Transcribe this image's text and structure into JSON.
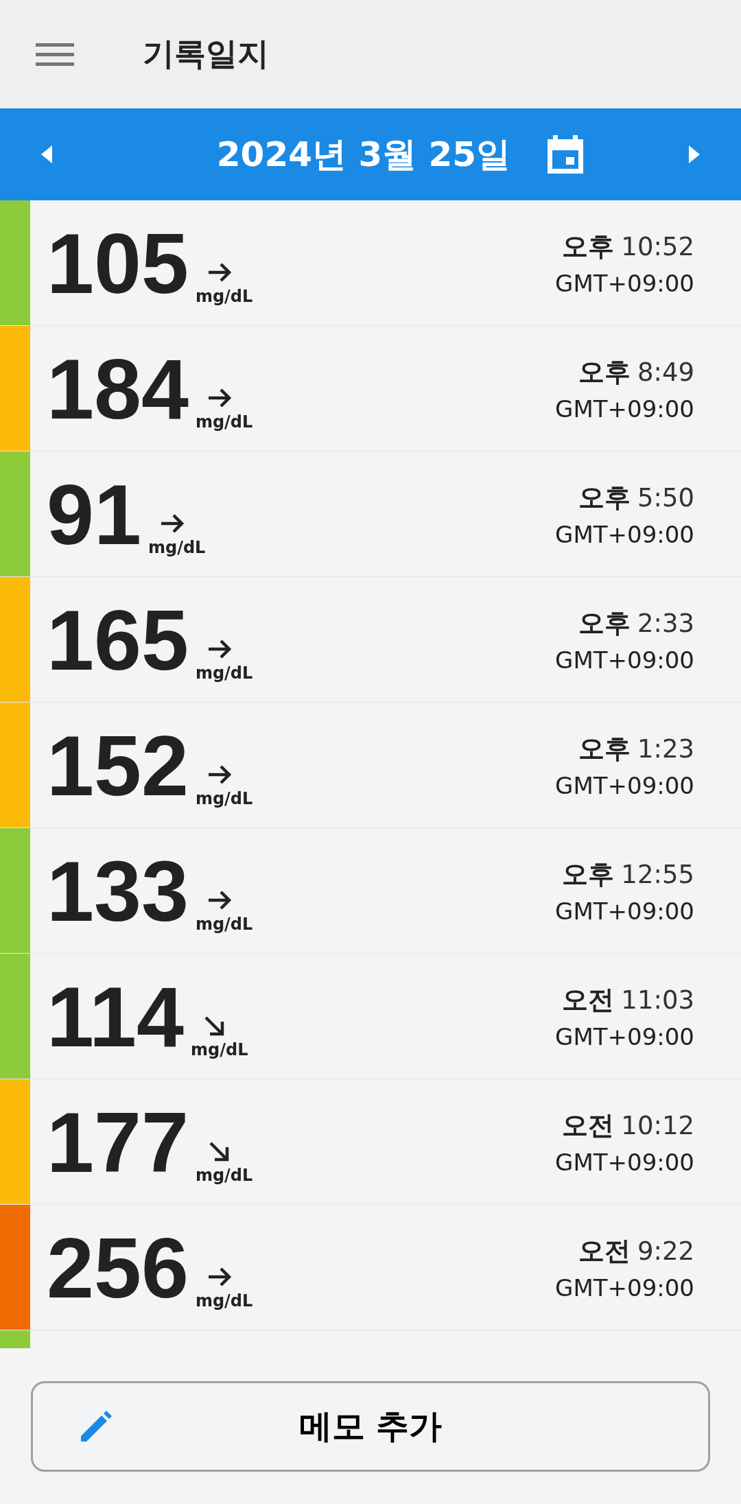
{
  "app_bar": {
    "title": "기록일지"
  },
  "date_bar": {
    "date": "2024년 3월 25일"
  },
  "readings": [
    {
      "value": "105",
      "kind": "steady",
      "unit": "mg/dL",
      "period": "오후",
      "time": "10:52",
      "timezone": "GMT+09:00",
      "color": "#8dcb3a"
    },
    {
      "value": "184",
      "kind": "steady",
      "unit": "mg/dL",
      "period": "오후",
      "time": "8:49",
      "timezone": "GMT+09:00",
      "color": "#fdbb09"
    },
    {
      "value": "91",
      "kind": "steady",
      "unit": "mg/dL",
      "period": "오후",
      "time": "5:50",
      "timezone": "GMT+09:00",
      "color": "#8dcb3a"
    },
    {
      "value": "165",
      "kind": "steady",
      "unit": "mg/dL",
      "period": "오후",
      "time": "2:33",
      "timezone": "GMT+09:00",
      "color": "#fdbb09"
    },
    {
      "value": "152",
      "kind": "steady",
      "unit": "mg/dL",
      "period": "오후",
      "time": "1:23",
      "timezone": "GMT+09:00",
      "color": "#fdbb09"
    },
    {
      "value": "133",
      "kind": "steady",
      "unit": "mg/dL",
      "period": "오후",
      "time": "12:55",
      "timezone": "GMT+09:00",
      "color": "#8dcb3a"
    },
    {
      "value": "114",
      "kind": "falling",
      "unit": "mg/dL",
      "period": "오전",
      "time": "11:03",
      "timezone": "GMT+09:00",
      "color": "#8dcb3a"
    },
    {
      "value": "177",
      "kind": "falling",
      "unit": "mg/dL",
      "period": "오전",
      "time": "10:12",
      "timezone": "GMT+09:00",
      "color": "#fdbb09"
    },
    {
      "value": "256",
      "kind": "steady",
      "unit": "mg/dL",
      "period": "오전",
      "time": "9:22",
      "timezone": "GMT+09:00",
      "color": "#ef6c00"
    }
  ],
  "partial_row": {
    "color": "#8dcb3a"
  },
  "add_memo_button": {
    "label": "메모 추가"
  }
}
